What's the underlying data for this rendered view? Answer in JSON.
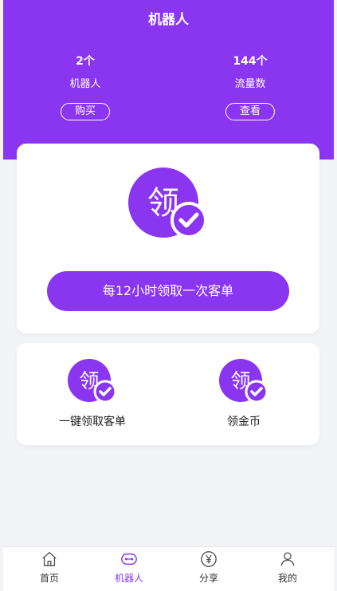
{
  "header": {
    "title": "机器人",
    "stats": [
      {
        "value": "2个",
        "label": "机器人",
        "button": "购买"
      },
      {
        "value": "144个",
        "label": "流量数",
        "button": "查看"
      }
    ]
  },
  "main_card": {
    "icon_char": "领",
    "claim_button": "每12小时领取一次客单"
  },
  "options": [
    {
      "icon_char": "领",
      "label": "一键领取客单"
    },
    {
      "icon_char": "领",
      "label": "领金币"
    }
  ],
  "tabbar": {
    "tabs": [
      {
        "label": "首页",
        "icon": "home-icon"
      },
      {
        "label": "机器人",
        "icon": "robot-icon"
      },
      {
        "label": "分享",
        "icon": "yen-icon"
      },
      {
        "label": "我的",
        "icon": "user-icon"
      }
    ],
    "active_index": 1
  },
  "colors": {
    "accent": "#8a36f1",
    "background": "#f3f4f8"
  }
}
